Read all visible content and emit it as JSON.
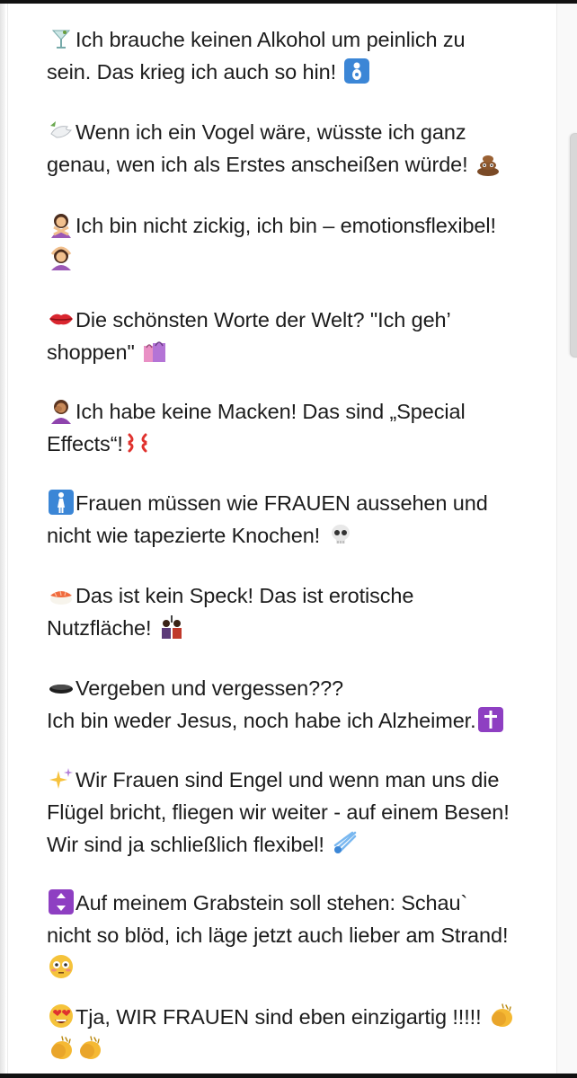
{
  "posts": [
    {
      "lead_icon": "cocktail-glass-icon",
      "lines": [
        "Ich brauche keinen Alkohol um peinlich zu",
        "sein. Das krieg ich auch so hin!"
      ],
      "tail_icons": [
        "baby-symbol-icon"
      ]
    },
    {
      "lead_icon": "dove-icon",
      "lines": [
        "Wenn ich ein Vogel wäre, wüsste ich ganz",
        "genau, wen ich als Erstes anscheißen würde!"
      ],
      "tail_icons": [
        "pile-of-poo-icon"
      ]
    },
    {
      "lead_icon": "woman-gesturing-no-icon",
      "lines": [
        "Ich bin nicht zickig, ich bin – emotionsflexibel!",
        ""
      ],
      "tail_icons": [
        "woman-gesturing-ok-icon"
      ]
    },
    {
      "lead_icon": "lips-icon",
      "lines": [
        "Die schönsten Worte der Welt? \"Ich geh’",
        "shoppen\""
      ],
      "tail_icons": [
        "shopping-bags-icon"
      ]
    },
    {
      "lead_icon": "woman-facepalming-icon",
      "lines": [
        "Ich habe keine Macken! Das sind „Special",
        "Effects“!"
      ],
      "tail_icons": [
        "anger-symbol-icon"
      ]
    },
    {
      "lead_icon": "womens-room-icon",
      "lines": [
        "Frauen müssen wie FRAUEN aussehen und",
        "nicht wie tapezierte Knochen!"
      ],
      "tail_icons": [
        "skull-icon"
      ]
    },
    {
      "lead_icon": "sushi-icon",
      "lines": [
        "Das ist kein Speck! Das ist erotische",
        "Nutzfläche!"
      ],
      "tail_icons": [
        "couple-icon"
      ]
    },
    {
      "lead_icon": "black-disc-icon",
      "lines": [
        "Vergeben und vergessen???",
        "Ich bin weder Jesus, noch habe ich Alzheimer."
      ],
      "tail_icons": [
        "latin-cross-icon"
      ]
    },
    {
      "lead_icon": "sparkles-icon",
      "lines": [
        "Wir Frauen sind Engel und wenn man uns die",
        "Flügel bricht, fliegen wir weiter - auf einem Besen!",
        "Wir sind ja schließlich flexibel!"
      ],
      "tail_icons": [
        "comet-icon"
      ]
    },
    {
      "lead_icon": "elevator-icon",
      "lines": [
        "Auf meinem Grabstein soll stehen: Schau`",
        "nicht so blöd, ich läge jetzt auch lieber am Strand!",
        ""
      ],
      "tail_icons": [
        "flushed-face-icon"
      ]
    },
    {
      "lead_icon": "heart-eyes-face-icon",
      "lines": [
        "Tja, WIR FRAUEN sind eben einzigartig !!!!!",
        ""
      ],
      "tail_icons": [
        "clapping-hands-icon",
        "clapping-hands-icon",
        "clapping-hands-icon"
      ]
    }
  ],
  "colors": {
    "text": "#1c1c1c",
    "background": "#ffffff",
    "blue_symbol": "#3b86d6",
    "purple_symbol": "#8e3fc2",
    "poo": "#7a4a26",
    "lips": "#d9262f",
    "clap": "#f5b933"
  }
}
